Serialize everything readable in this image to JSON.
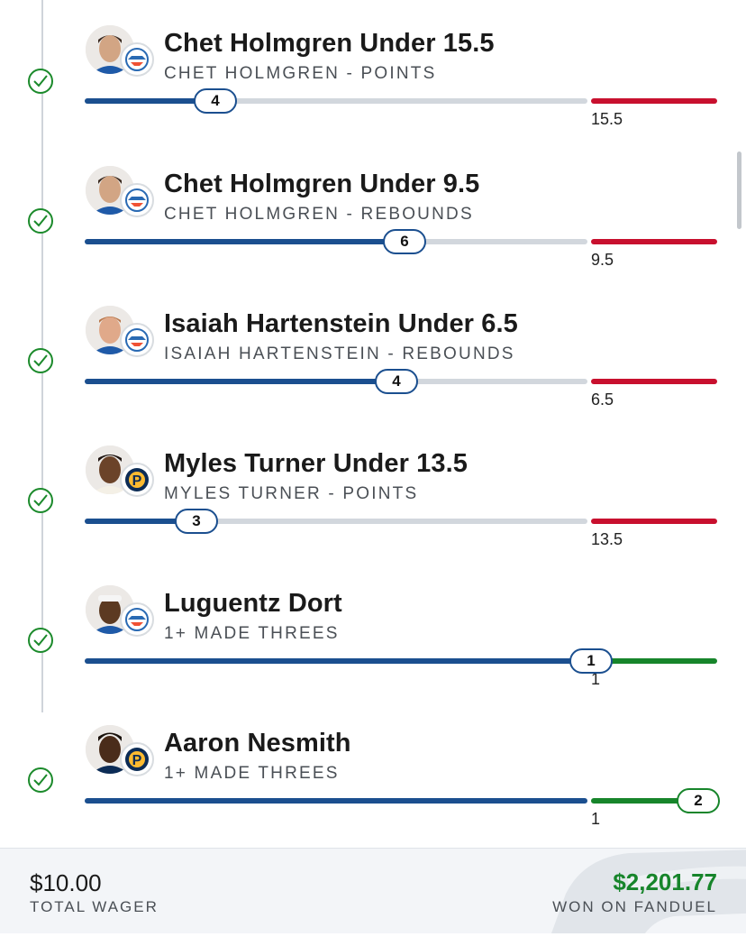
{
  "legs": [
    {
      "title": "Chet Holmgren Under 15.5",
      "subtitle": "CHET HOLMGREN - POINTS",
      "progress": 4,
      "target": "15.5",
      "team": "okc-thunder-logo",
      "result_color": "#c8102e",
      "progress_fraction": 0.26
    },
    {
      "title": "Chet Holmgren Under 9.5",
      "subtitle": "CHET HOLMGREN - REBOUNDS",
      "progress": 6,
      "target": "9.5",
      "team": "okc-thunder-logo",
      "result_color": "#c8102e",
      "progress_fraction": 0.63
    },
    {
      "title": "Isaiah Hartenstein Under 6.5",
      "subtitle": "ISAIAH HARTENSTEIN - REBOUNDS",
      "progress": 4,
      "target": "6.5",
      "team": "okc-thunder-logo",
      "result_color": "#c8102e",
      "progress_fraction": 0.62
    },
    {
      "title": "Myles Turner Under 13.5",
      "subtitle": "MYLES TURNER - POINTS",
      "progress": 3,
      "target": "13.5",
      "team": "indiana-pacers-logo",
      "result_color": "#c8102e",
      "progress_fraction": 0.22
    },
    {
      "title": "Luguentz Dort",
      "subtitle": "1+ MADE THREES",
      "progress": 1,
      "target": "1",
      "team": "okc-thunder-logo",
      "result_color": "#17852b",
      "progress_fraction": 1.0
    },
    {
      "title": "Aaron Nesmith",
      "subtitle": "1+ MADE THREES",
      "progress": 2,
      "target": "1",
      "team": "indiana-pacers-logo",
      "result_color": "#17852b",
      "progress_fraction": 1.26
    }
  ],
  "footer": {
    "wager_amount": "$10.00",
    "wager_label": "TOTAL WAGER",
    "won_amount": "$2,201.77",
    "won_label": "WON ON FANDUEL"
  },
  "colors": {
    "progress_blue": "#1b4f8f",
    "miss_red": "#c8102e",
    "win_green": "#17852b"
  },
  "icons": {
    "status": "check-circle-icon",
    "team_logos": [
      "okc-thunder-logo",
      "indiana-pacers-logo"
    ]
  }
}
